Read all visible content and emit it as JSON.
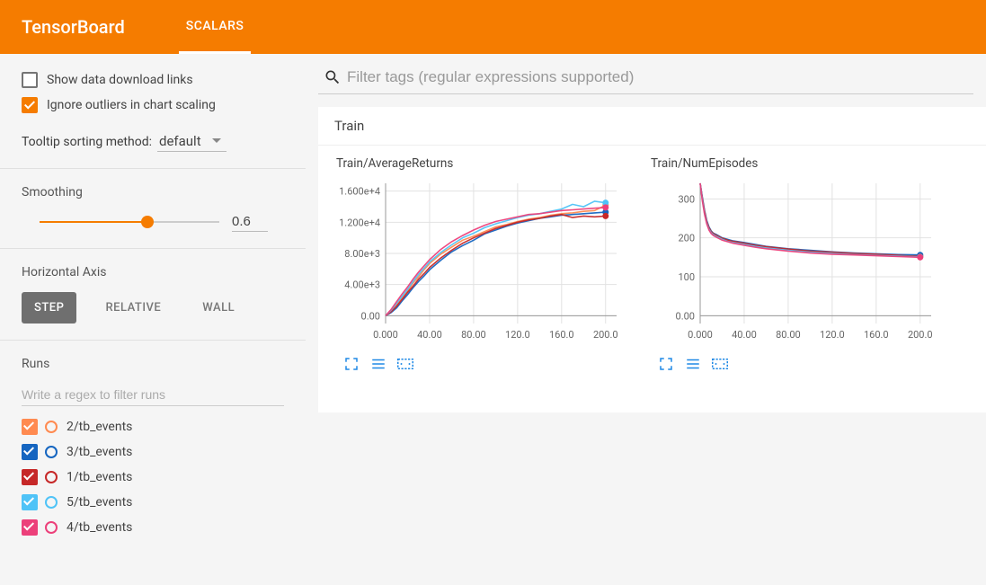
{
  "app_title": "TensorBoard",
  "active_tab": "SCALARS",
  "checkboxes": {
    "download_links": {
      "label": "Show data download links",
      "checked": false
    },
    "ignore_outliers": {
      "label": "Ignore outliers in chart scaling",
      "checked": true
    }
  },
  "tooltip_sort": {
    "label": "Tooltip sorting method:",
    "value": "default"
  },
  "smoothing": {
    "label": "Smoothing",
    "value": "0.6",
    "ratio": 0.6
  },
  "haxis": {
    "label": "Horizontal Axis",
    "options": [
      "STEP",
      "RELATIVE",
      "WALL"
    ],
    "active": "STEP"
  },
  "runs": {
    "label": "Runs",
    "filter_placeholder": "Write a regex to filter runs",
    "items": [
      {
        "label": "2/tb_events",
        "color": "#ff8a50"
      },
      {
        "label": "3/tb_events",
        "color": "#1565c0"
      },
      {
        "label": "1/tb_events",
        "color": "#c62828"
      },
      {
        "label": "5/tb_events",
        "color": "#4fc3f7"
      },
      {
        "label": "4/tb_events",
        "color": "#ec407a"
      }
    ]
  },
  "filter_placeholder": "Filter tags (regular expressions supported)",
  "panel_title": "Train",
  "chart_data": [
    {
      "type": "line",
      "title": "Train/AverageReturns",
      "xlabel": "",
      "ylabel": "",
      "xlim": [
        0,
        210
      ],
      "ylim": [
        -1000,
        17000
      ],
      "xticks": [
        0,
        40,
        80,
        120,
        160,
        200
      ],
      "xticklabels": [
        "0.000",
        "40.00",
        "80.00",
        "120.0",
        "160.0",
        "200.0"
      ],
      "yticks": [
        0,
        4000,
        8000,
        12000,
        16000
      ],
      "yticklabels": [
        "0.00",
        "4.00e+3",
        "8.00e+3",
        "1.200e+4",
        "1.600e+4"
      ],
      "series": [
        {
          "name": "2/tb_events",
          "color": "#ff8a50",
          "values": [
            [
              0,
              0
            ],
            [
              5,
              600
            ],
            [
              10,
              1400
            ],
            [
              15,
              2300
            ],
            [
              20,
              3200
            ],
            [
              25,
              4200
            ],
            [
              30,
              5000
            ],
            [
              35,
              5900
            ],
            [
              40,
              6700
            ],
            [
              50,
              7900
            ],
            [
              60,
              8800
            ],
            [
              70,
              9700
            ],
            [
              80,
              10200
            ],
            [
              90,
              10800
            ],
            [
              100,
              11400
            ],
            [
              110,
              11700
            ],
            [
              120,
              12100
            ],
            [
              130,
              12400
            ],
            [
              140,
              12600
            ],
            [
              150,
              12900
            ],
            [
              160,
              13100
            ],
            [
              170,
              13200
            ],
            [
              180,
              13400
            ],
            [
              190,
              13500
            ],
            [
              200,
              14200
            ]
          ]
        },
        {
          "name": "3/tb_events",
          "color": "#1565c0",
          "values": [
            [
              0,
              0
            ],
            [
              5,
              400
            ],
            [
              10,
              1000
            ],
            [
              15,
              1900
            ],
            [
              20,
              2700
            ],
            [
              25,
              3600
            ],
            [
              30,
              4400
            ],
            [
              35,
              5100
            ],
            [
              40,
              5900
            ],
            [
              50,
              7100
            ],
            [
              60,
              8200
            ],
            [
              70,
              9000
            ],
            [
              80,
              9700
            ],
            [
              90,
              10500
            ],
            [
              100,
              11000
            ],
            [
              110,
              11500
            ],
            [
              120,
              11900
            ],
            [
              130,
              12200
            ],
            [
              140,
              12500
            ],
            [
              150,
              12700
            ],
            [
              160,
              12900
            ],
            [
              170,
              13000
            ],
            [
              180,
              13100
            ],
            [
              190,
              13200
            ],
            [
              200,
              13300
            ]
          ]
        },
        {
          "name": "1/tb_events",
          "color": "#c62828",
          "values": [
            [
              0,
              0
            ],
            [
              5,
              500
            ],
            [
              10,
              1200
            ],
            [
              15,
              2100
            ],
            [
              20,
              3000
            ],
            [
              25,
              3800
            ],
            [
              30,
              4700
            ],
            [
              35,
              5400
            ],
            [
              40,
              6200
            ],
            [
              50,
              7400
            ],
            [
              60,
              8400
            ],
            [
              70,
              9300
            ],
            [
              80,
              10000
            ],
            [
              90,
              10600
            ],
            [
              100,
              11200
            ],
            [
              110,
              11600
            ],
            [
              120,
              12000
            ],
            [
              130,
              12300
            ],
            [
              140,
              12500
            ],
            [
              150,
              12800
            ],
            [
              160,
              13000
            ],
            [
              170,
              12600
            ],
            [
              180,
              12800
            ],
            [
              190,
              12700
            ],
            [
              200,
              12800
            ]
          ]
        },
        {
          "name": "5/tb_events",
          "color": "#4fc3f7",
          "values": [
            [
              0,
              0
            ],
            [
              5,
              700
            ],
            [
              10,
              1600
            ],
            [
              15,
              2500
            ],
            [
              20,
              3400
            ],
            [
              25,
              4400
            ],
            [
              30,
              5300
            ],
            [
              35,
              6100
            ],
            [
              40,
              6900
            ],
            [
              50,
              8100
            ],
            [
              60,
              9100
            ],
            [
              70,
              10000
            ],
            [
              80,
              10600
            ],
            [
              90,
              11300
            ],
            [
              100,
              11800
            ],
            [
              110,
              12200
            ],
            [
              120,
              12600
            ],
            [
              130,
              12900
            ],
            [
              140,
              13100
            ],
            [
              150,
              13400
            ],
            [
              160,
              13700
            ],
            [
              170,
              14300
            ],
            [
              180,
              14000
            ],
            [
              190,
              14700
            ],
            [
              200,
              14500
            ]
          ]
        },
        {
          "name": "4/tb_events",
          "color": "#ec407a",
          "values": [
            [
              0,
              0
            ],
            [
              5,
              800
            ],
            [
              10,
              1800
            ],
            [
              15,
              2800
            ],
            [
              20,
              3700
            ],
            [
              25,
              4700
            ],
            [
              30,
              5600
            ],
            [
              35,
              6400
            ],
            [
              40,
              7200
            ],
            [
              50,
              8500
            ],
            [
              60,
              9500
            ],
            [
              70,
              10300
            ],
            [
              80,
              11000
            ],
            [
              90,
              11600
            ],
            [
              100,
              12100
            ],
            [
              110,
              12400
            ],
            [
              120,
              12700
            ],
            [
              130,
              13000
            ],
            [
              140,
              13100
            ],
            [
              150,
              13300
            ],
            [
              160,
              13500
            ],
            [
              170,
              13600
            ],
            [
              180,
              13700
            ],
            [
              190,
              13800
            ],
            [
              200,
              13900
            ]
          ]
        }
      ]
    },
    {
      "type": "line",
      "title": "Train/NumEpisodes",
      "xlabel": "",
      "ylabel": "",
      "xlim": [
        0,
        210
      ],
      "ylim": [
        -20,
        340
      ],
      "xticks": [
        0,
        40,
        80,
        120,
        160,
        200
      ],
      "xticklabels": [
        "0.000",
        "40.00",
        "80.00",
        "120.0",
        "160.0",
        "200.0"
      ],
      "yticks": [
        0,
        100,
        200,
        300
      ],
      "yticklabels": [
        "0.00",
        "100",
        "200",
        "300"
      ],
      "series": [
        {
          "name": "2/tb_events",
          "color": "#ff8a50",
          "values": [
            [
              0,
              340
            ],
            [
              2,
              300
            ],
            [
              4,
              265
            ],
            [
              6,
              240
            ],
            [
              8,
              225
            ],
            [
              10,
              215
            ],
            [
              12,
              210
            ],
            [
              15,
              205
            ],
            [
              20,
              198
            ],
            [
              25,
              193
            ],
            [
              30,
              190
            ],
            [
              40,
              185
            ],
            [
              50,
              180
            ],
            [
              60,
              176
            ],
            [
              80,
              170
            ],
            [
              100,
              165
            ],
            [
              120,
              162
            ],
            [
              140,
              159
            ],
            [
              160,
              157
            ],
            [
              180,
              156
            ],
            [
              200,
              154
            ]
          ]
        },
        {
          "name": "3/tb_events",
          "color": "#1565c0",
          "values": [
            [
              0,
              340
            ],
            [
              2,
              305
            ],
            [
              4,
              270
            ],
            [
              6,
              245
            ],
            [
              8,
              228
            ],
            [
              10,
              218
            ],
            [
              12,
              212
            ],
            [
              15,
              208
            ],
            [
              20,
              200
            ],
            [
              25,
              196
            ],
            [
              30,
              192
            ],
            [
              40,
              188
            ],
            [
              50,
              183
            ],
            [
              60,
              178
            ],
            [
              80,
              172
            ],
            [
              100,
              168
            ],
            [
              120,
              164
            ],
            [
              140,
              161
            ],
            [
              160,
              159
            ],
            [
              180,
              157
            ],
            [
              200,
              156
            ]
          ]
        },
        {
          "name": "1/tb_events",
          "color": "#c62828",
          "values": [
            [
              0,
              340
            ],
            [
              2,
              302
            ],
            [
              4,
              268
            ],
            [
              6,
              242
            ],
            [
              8,
              226
            ],
            [
              10,
              216
            ],
            [
              12,
              211
            ],
            [
              15,
              206
            ],
            [
              20,
              199
            ],
            [
              25,
              194
            ],
            [
              30,
              191
            ],
            [
              40,
              186
            ],
            [
              50,
              181
            ],
            [
              60,
              177
            ],
            [
              80,
              171
            ],
            [
              100,
              166
            ],
            [
              120,
              163
            ],
            [
              140,
              160
            ],
            [
              160,
              158
            ],
            [
              180,
              155
            ],
            [
              200,
              152
            ]
          ]
        },
        {
          "name": "5/tb_events",
          "color": "#4fc3f7",
          "values": [
            [
              0,
              340
            ],
            [
              2,
              298
            ],
            [
              4,
              262
            ],
            [
              6,
              238
            ],
            [
              8,
              222
            ],
            [
              10,
              213
            ],
            [
              12,
              208
            ],
            [
              15,
              203
            ],
            [
              20,
              196
            ],
            [
              25,
              191
            ],
            [
              30,
              188
            ],
            [
              40,
              183
            ],
            [
              50,
              178
            ],
            [
              60,
              174
            ],
            [
              80,
              168
            ],
            [
              100,
              163
            ],
            [
              120,
              160
            ],
            [
              140,
              157
            ],
            [
              160,
              155
            ],
            [
              180,
              153
            ],
            [
              200,
              151
            ]
          ]
        },
        {
          "name": "4/tb_events",
          "color": "#ec407a",
          "values": [
            [
              0,
              340
            ],
            [
              2,
              295
            ],
            [
              4,
              260
            ],
            [
              6,
              236
            ],
            [
              8,
              220
            ],
            [
              10,
              211
            ],
            [
              12,
              206
            ],
            [
              15,
              201
            ],
            [
              20,
              194
            ],
            [
              25,
              190
            ],
            [
              30,
              186
            ],
            [
              40,
              181
            ],
            [
              50,
              176
            ],
            [
              60,
              172
            ],
            [
              80,
              166
            ],
            [
              100,
              161
            ],
            [
              120,
              158
            ],
            [
              140,
              156
            ],
            [
              160,
              154
            ],
            [
              180,
              152
            ],
            [
              200,
              150
            ]
          ]
        }
      ]
    }
  ]
}
